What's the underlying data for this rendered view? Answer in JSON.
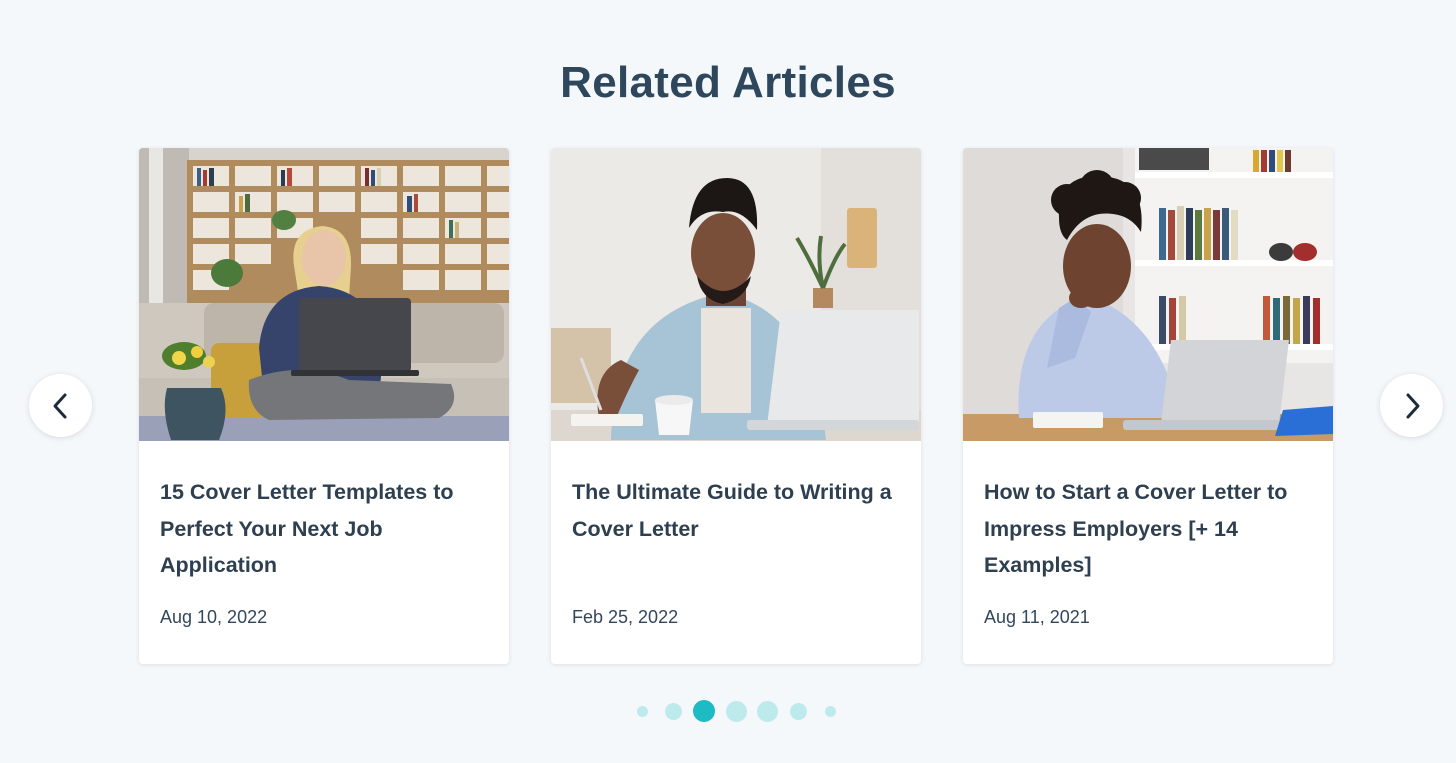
{
  "section": {
    "title": "Related Articles"
  },
  "articles": [
    {
      "title": "15 Cover Letter Templates to Perfect Your Next Job Application",
      "date": "Aug 10, 2022",
      "image": "woman-with-laptop-on-sofa"
    },
    {
      "title": "The Ultimate Guide to Writing a Cover Letter",
      "date": "Feb 25, 2022",
      "image": "man-writing-at-desk-with-laptop"
    },
    {
      "title": "How to Start a Cover Letter to Impress Employers [+ 14 Examples]",
      "date": "Aug 11, 2021",
      "image": "woman-thinking-at-desk-with-laptop"
    }
  ],
  "navigation": {
    "prev_icon": "chevron-left-icon",
    "next_icon": "chevron-right-icon"
  },
  "pagination": {
    "total": 7,
    "active_index": 2
  },
  "colors": {
    "background": "#f5f8fb",
    "heading": "#2e475d",
    "dot_active": "#1fbbc4",
    "dot_inactive": "#bdeaec"
  }
}
